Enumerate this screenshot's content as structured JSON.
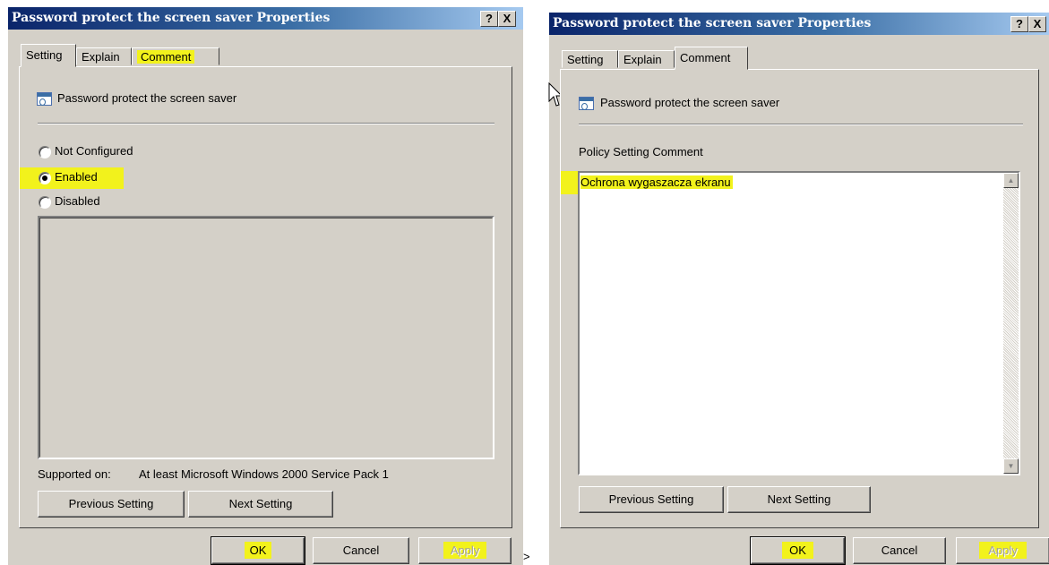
{
  "left_dialog": {
    "title": "Password protect the screen saver Properties",
    "help_btn": "?",
    "close_btn": "X",
    "tabs": [
      "Setting",
      "Explain",
      "Comment"
    ],
    "active_tab": "Setting",
    "policy_name": "Password protect the screen saver",
    "radio_options": [
      {
        "label": "Not Configured",
        "checked": false
      },
      {
        "label": "Enabled",
        "checked": true
      },
      {
        "label": "Disabled",
        "checked": false
      }
    ],
    "supported_on_label": "Supported on:",
    "supported_on_value": "At least Microsoft Windows 2000 Service Pack 1",
    "prev_btn": "Previous Setting",
    "next_btn": "Next Setting",
    "ok_btn": "OK",
    "cancel_btn": "Cancel",
    "apply_btn": "Apply"
  },
  "right_dialog": {
    "title": "Password protect the screen saver Properties",
    "help_btn": "?",
    "close_btn": "X",
    "tabs": [
      "Setting",
      "Explain",
      "Comment"
    ],
    "active_tab": "Comment",
    "policy_name": "Password protect the screen saver",
    "comment_label": "Policy Setting Comment",
    "comment_value": "Ochrona wygaszacza ekranu",
    "prev_btn": "Previous Setting",
    "next_btn": "Next Setting",
    "ok_btn": "OK",
    "cancel_btn": "Cancel",
    "apply_btn": "Apply"
  },
  "separator": ">",
  "colors": {
    "titlebar_start": "#0a246a",
    "titlebar_end": "#a6caf0",
    "dialog_face": "#d4d0c8",
    "highlight": "#f2f21c"
  },
  "icons": [
    "policy-icon",
    "mouse-pointer-icon",
    "scroll-up-arrow-icon",
    "scroll-down-arrow-icon"
  ]
}
